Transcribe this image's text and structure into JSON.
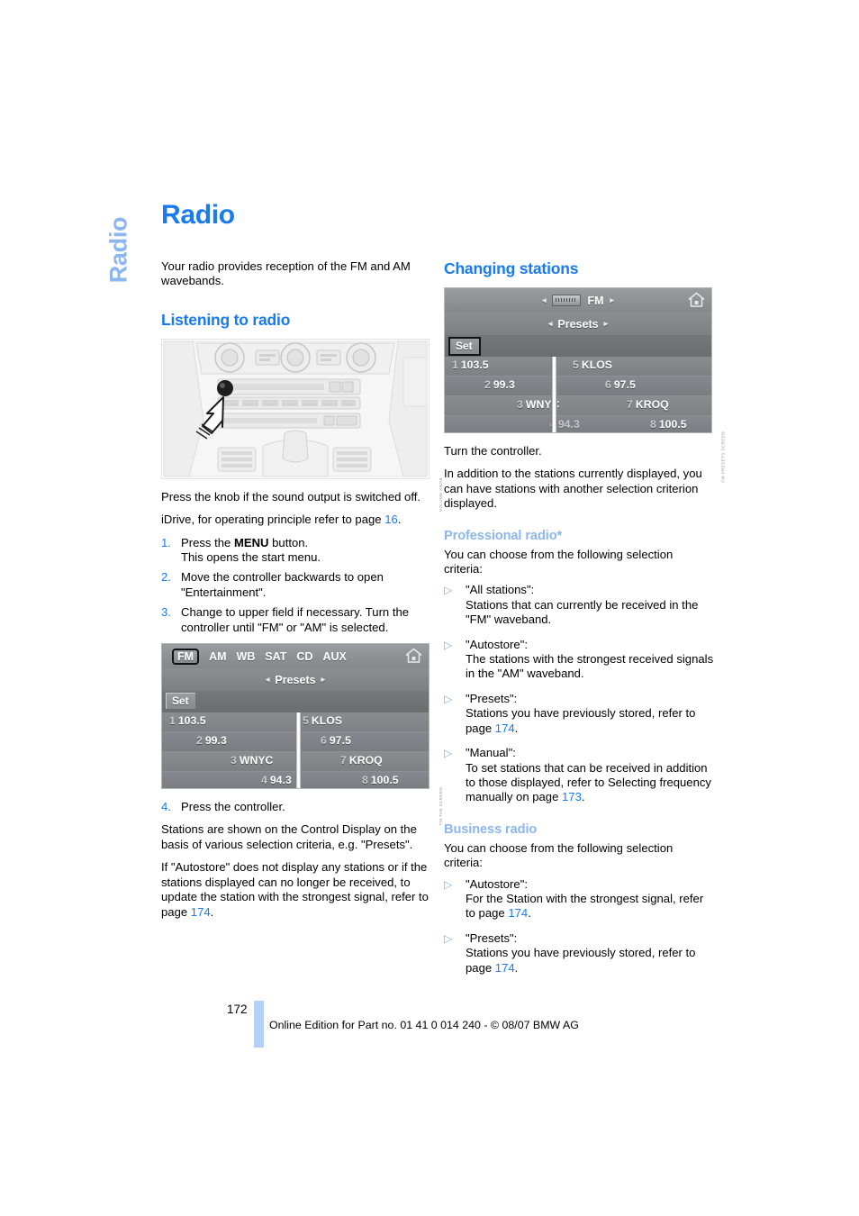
{
  "chapter_tab": "Radio",
  "page_title": "Radio",
  "left_column": {
    "intro": "Your radio provides reception of the FM and AM wavebands.",
    "section_heading": "Listening to radio",
    "console_figure": {
      "name": "center-console-volume-knob",
      "code": "VOLUME KNOB"
    },
    "para_knob": "Press the knob if the sound output is switched off.",
    "para_idrive_pre": "iDrive, for operating principle refer to page ",
    "para_idrive_ref": "16",
    "para_idrive_post": ".",
    "steps": [
      {
        "num": "1.",
        "pre": "Press the ",
        "bold": "MENU",
        "post": " button.",
        "second_line": "This opens the start menu."
      },
      {
        "num": "2.",
        "pre": "Move the controller backwards to open \"Entertainment\".",
        "bold": "",
        "post": "",
        "second_line": ""
      },
      {
        "num": "3.",
        "pre": "Change to upper field if necessary. Turn the controller until \"FM\" or \"AM\" is selected.",
        "bold": "",
        "post": "",
        "second_line": ""
      }
    ],
    "idrive_tabs_figure": {
      "name": "idrive-waveband-tabs-screen",
      "code": "FM TAB SCREEN",
      "tabs": [
        "FM",
        "AM",
        "WB",
        "SAT",
        "CD",
        "AUX"
      ],
      "selected_tab": "FM",
      "presets_label": "Presets",
      "set_label": "Set",
      "home_icon": "home-icon",
      "left_arrow": "◂",
      "right_arrow": "▸"
    },
    "step4": {
      "num": "4.",
      "text": "Press the controller."
    },
    "para_stations": "Stations are shown on the Control Display on the basis of various selection criteria, e.g. \"Presets\".",
    "para_autostore_pre": "If \"Autostore\" does not display any stations or if the stations displayed can no longer be received, to update the station with the strongest signal, refer to page ",
    "para_autostore_ref": "174",
    "para_autostore_post": "."
  },
  "right_column": {
    "section_heading": "Changing stations",
    "idrive_fm_figure": {
      "name": "idrive-changing-stations-screen",
      "code": "FM PRESETS SCREEN",
      "band_label": "FM",
      "presets_label": "Presets",
      "set_label": "Set",
      "home_icon": "home-icon",
      "radio_chip_icon": "radio-chip-icon",
      "left_arrow": "◂",
      "right_arrow": "▸"
    },
    "para_turn": "Turn the controller.",
    "para_addition": "In addition to the stations currently displayed, you can have stations with another selection criterion displayed.",
    "professional": {
      "heading": "Professional radio*",
      "intro": "You can choose from the following selection criteria:",
      "bullets": [
        {
          "title": "\"All stations\":",
          "body_pre": "Stations that can currently be received in the \"FM\" waveband.",
          "ref": "",
          "body_post": ""
        },
        {
          "title": "\"Autostore\":",
          "body_pre": "The stations with the strongest received signals in the \"AM\" waveband.",
          "ref": "",
          "body_post": ""
        },
        {
          "title": "\"Presets\":",
          "body_pre": "Stations you have previously stored, refer to page ",
          "ref": "174",
          "body_post": "."
        },
        {
          "title": "\"Manual\":",
          "body_pre": "To set stations that can be received in addition to those displayed, refer to Selecting frequency manually on page ",
          "ref": "173",
          "body_post": "."
        }
      ]
    },
    "business": {
      "heading": "Business radio",
      "intro": "You can choose from the following selection criteria:",
      "bullets": [
        {
          "title": "\"Autostore\":",
          "body_pre": "For the Station with the strongest signal, refer to page ",
          "ref": "174",
          "body_post": "."
        },
        {
          "title": "\"Presets\":",
          "body_pre": "Stations you have previously stored, refer to page ",
          "ref": "174",
          "body_post": "."
        }
      ]
    }
  },
  "presets": {
    "rows": [
      {
        "left_num": "1",
        "left_value": "103.5",
        "right_num": "5",
        "right_value": "KLOS"
      },
      {
        "left_num": "2",
        "left_value": "99.3",
        "right_num": "6",
        "right_value": "97.5"
      },
      {
        "left_num": "3",
        "left_value": "WNYC",
        "right_num": "7",
        "right_value": "KROQ"
      },
      {
        "left_num": "4",
        "left_value": "94.3",
        "right_num": "8",
        "right_value": "100.5"
      }
    ]
  },
  "footer": {
    "page_number": "172",
    "text": "Online Edition for Part no. 01 41 0 014 240 - © 08/07 BMW AG"
  },
  "colors": {
    "heading_blue": "#1a7af0",
    "light_blue": "#8cb6ef",
    "footer_bar": "#b3d0f5"
  }
}
